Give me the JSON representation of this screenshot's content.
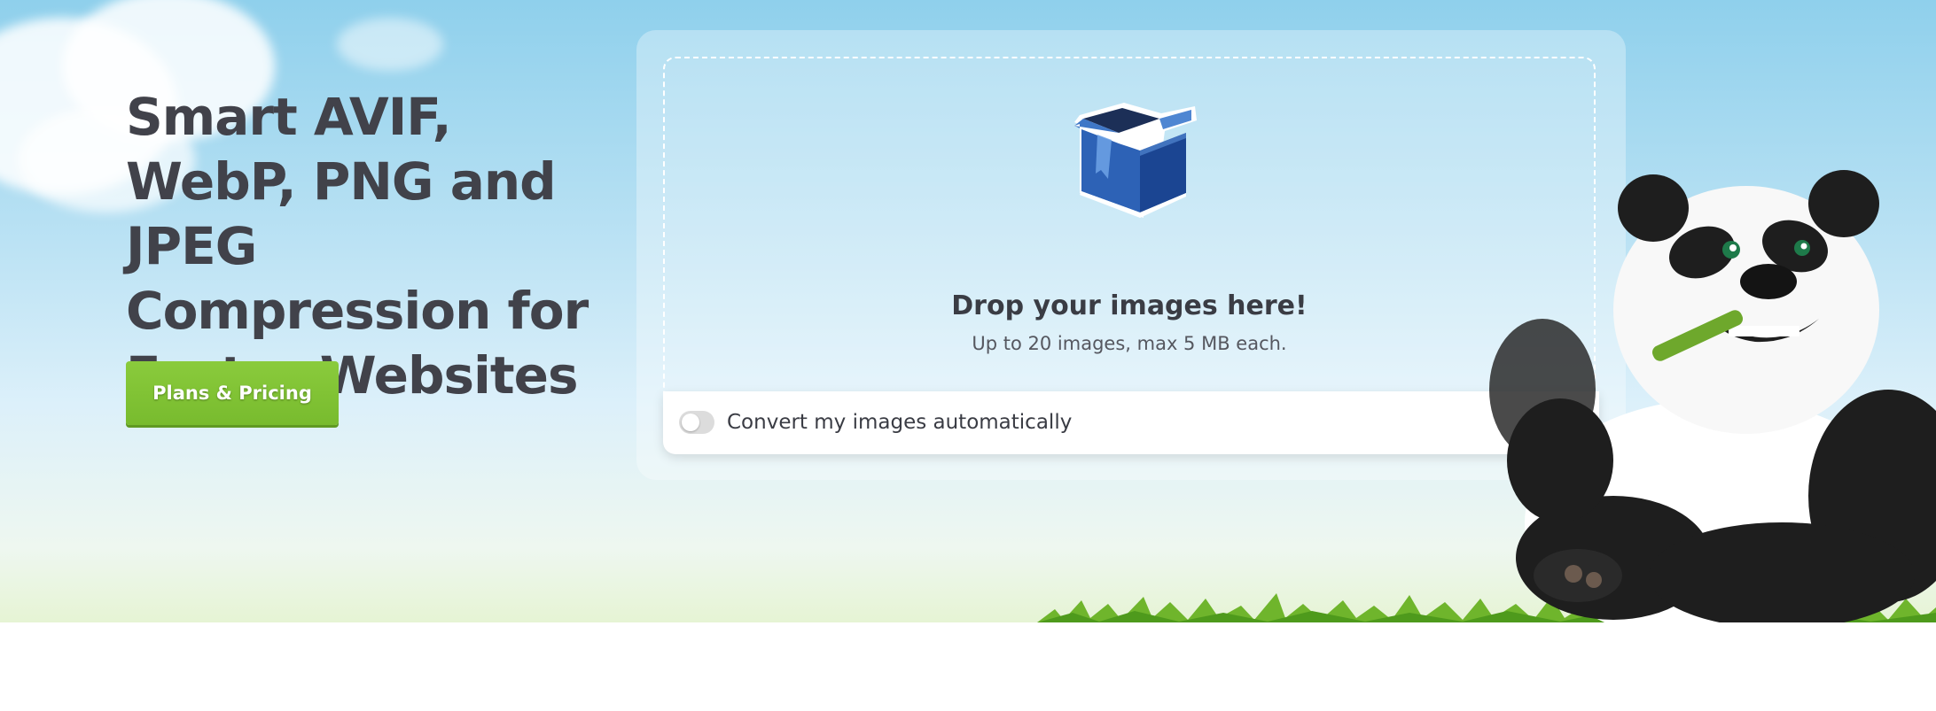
{
  "hero": {
    "headline": "Smart AVIF, WebP, PNG and JPEG Compression for Faster Websites",
    "cta_label": "Plans & Pricing"
  },
  "uploader": {
    "icon": "open-box-icon",
    "title": "Drop your images here!",
    "subtitle": "Up to 20 images, max 5 MB each.",
    "convert_label": "Convert my images automatically",
    "convert_enabled": false
  },
  "mascot": "panda-mascot",
  "colors": {
    "headline": "#41424a",
    "cta": "#7fc234",
    "sky_top": "#8fd0ec",
    "text_dark": "#3a3c44"
  }
}
